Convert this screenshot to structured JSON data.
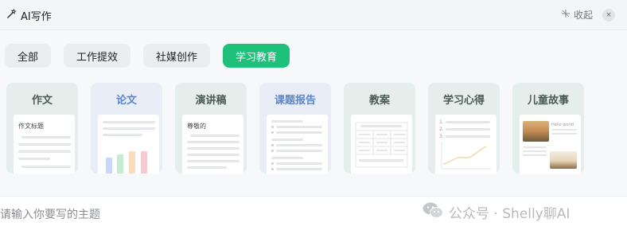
{
  "header": {
    "title": "AI写作",
    "collapse_label": "收起",
    "close_symbol": "×"
  },
  "tabs": [
    {
      "label": "全部",
      "active": false
    },
    {
      "label": "工作提效",
      "active": false
    },
    {
      "label": "社媒创作",
      "active": false
    },
    {
      "label": "学习教育",
      "active": true
    }
  ],
  "cards": [
    {
      "label": "作文",
      "preview_text": "作文标题"
    },
    {
      "label": "论文"
    },
    {
      "label": "演讲稿",
      "preview_text": "尊敬的"
    },
    {
      "label": "课题报告"
    },
    {
      "label": "教案"
    },
    {
      "label": "学习心得",
      "preview_text": [
        "1.",
        "2.",
        "3."
      ]
    },
    {
      "label": "儿童故事",
      "preview_text": "Hello world"
    }
  ],
  "input": {
    "placeholder": "请输入你要写的主题",
    "value": ""
  },
  "watermark": {
    "text": "公众号 · Shelly聊AI"
  },
  "colors": {
    "accent": "#1fc07a",
    "blue_title": "#5b86c9"
  },
  "icons": [
    "magic-wand-icon",
    "collapse-icon",
    "close-icon",
    "wechat-icon"
  ]
}
